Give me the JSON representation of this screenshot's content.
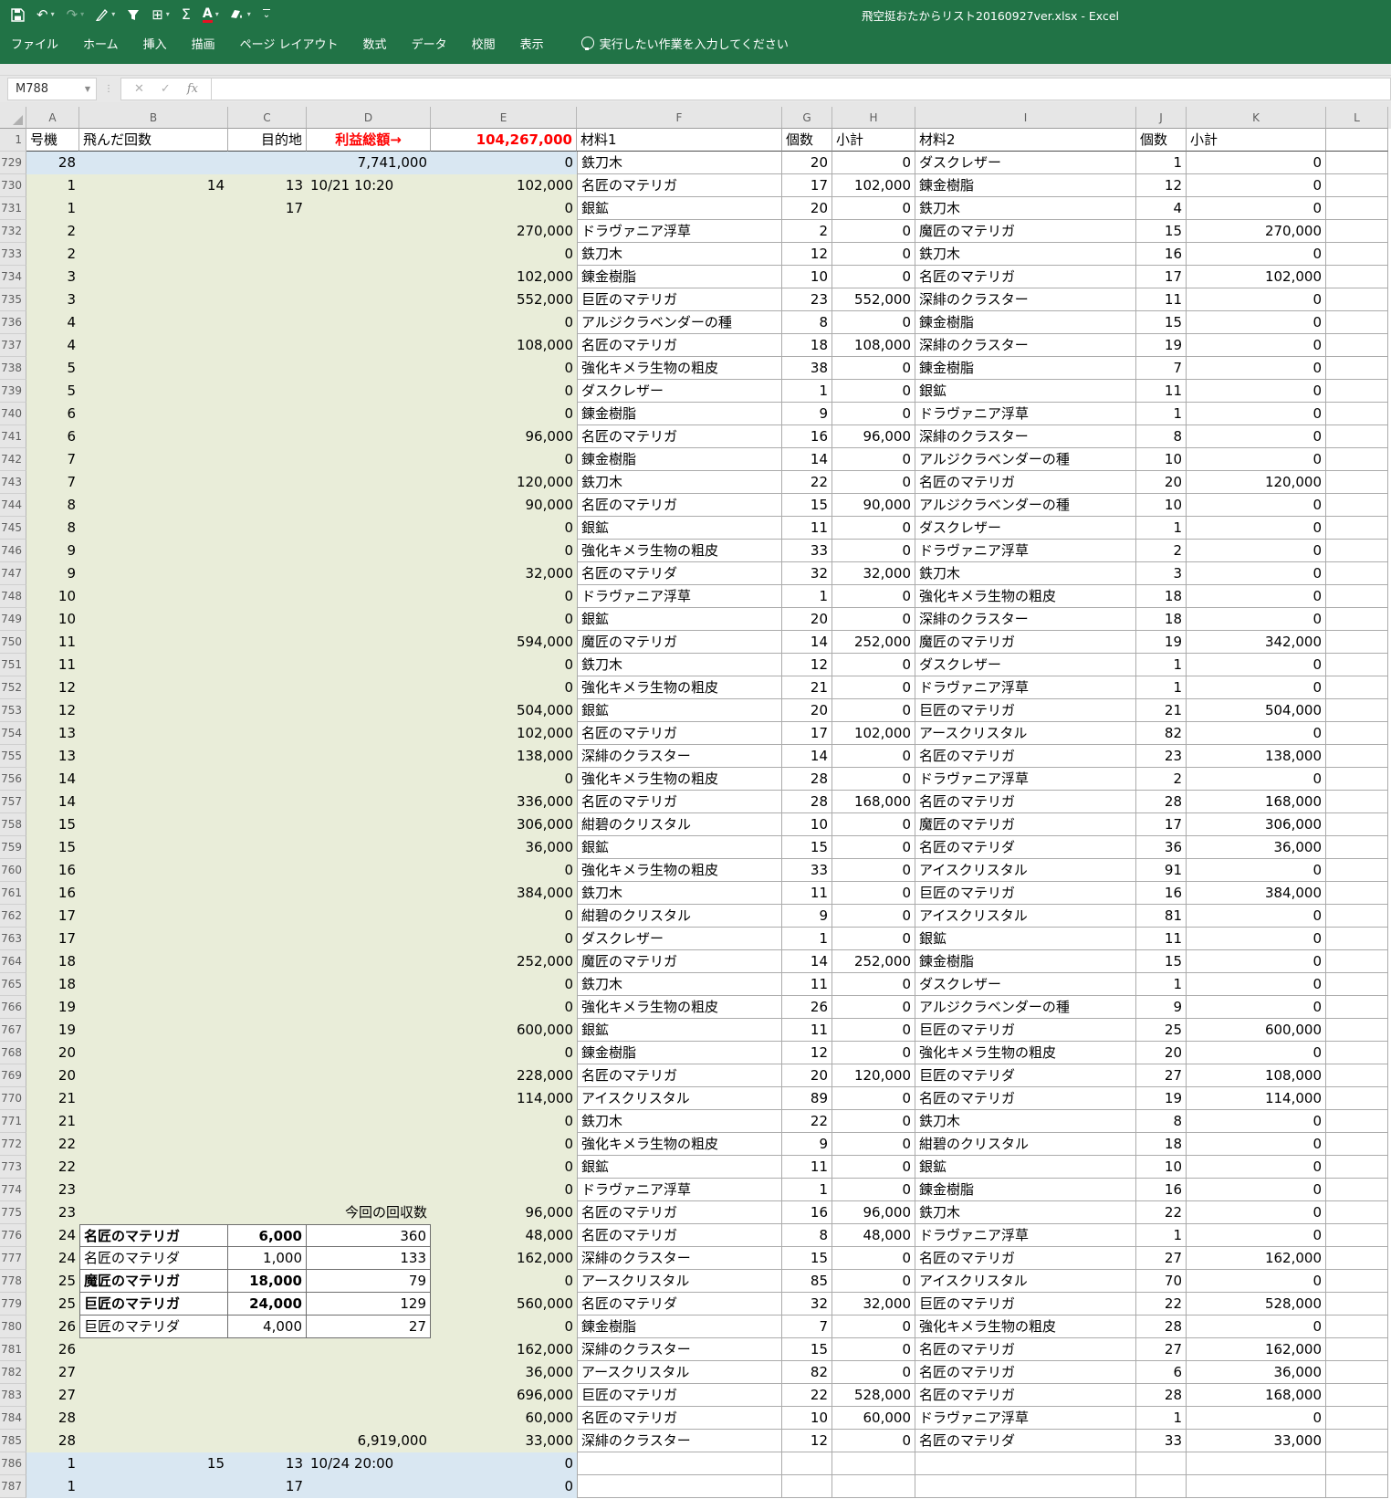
{
  "titlebar": {
    "title": "飛空挺おたからリスト20160927ver.xlsx  -  Excel"
  },
  "qat": {
    "icons": [
      "save-icon",
      "undo-icon",
      "redo-icon",
      "ink-pen-icon",
      "filter-icon",
      "borders-icon",
      "autosum-icon",
      "font-color-icon",
      "fill-color-icon",
      "customize-qat-icon"
    ],
    "undo_glyph": "↶",
    "redo_glyph": "↷",
    "borders_glyph": "⊞",
    "autosum_glyph": "Σ",
    "font_color_glyph": "A",
    "caret_glyph": "▾",
    "customize_glyph": "⌄"
  },
  "ribbon": {
    "tabs": [
      "ファイル",
      "ホーム",
      "挿入",
      "描画",
      "ページ レイアウト",
      "数式",
      "データ",
      "校閲",
      "表示"
    ],
    "tell_me": "実行したい作業を入力してください"
  },
  "formula_bar": {
    "name_box": "M788",
    "name_caret": "▼",
    "dots": "⋮",
    "cancel_glyph": "✕",
    "enter_glyph": "✓",
    "fx_glyph": "fx",
    "formula_value": ""
  },
  "grid": {
    "column_letters": [
      "A",
      "B",
      "C",
      "D",
      "E",
      "F",
      "G",
      "H",
      "I",
      "J",
      "K",
      "L"
    ],
    "header_row": {
      "n": "1",
      "cells": [
        "号機",
        "飛んだ回数",
        "目的地",
        "利益総額→",
        "104,267,000",
        "材料1",
        "個数",
        "小計",
        "材料2",
        "個数",
        "小計"
      ]
    },
    "colors": {
      "red_accent": "#ff0000",
      "blue_fill": "#d9e7f2",
      "green_fill": "#e9edd9",
      "chrome_green": "#217346"
    },
    "rows": [
      {
        "n": 729,
        "t": "blue",
        "c": [
          "28",
          "",
          "",
          "7,741,000",
          "0",
          "鉄刀木",
          "20",
          "0",
          "ダスクレザー",
          "1",
          "0"
        ]
      },
      {
        "n": 730,
        "t": "green",
        "c": [
          "1",
          "14",
          "13",
          "10/21 10:20",
          "102,000",
          "名匠のマテリガ",
          "17",
          "102,000",
          "錬金樹脂",
          "12",
          "0"
        ]
      },
      {
        "n": 731,
        "t": "green",
        "c": [
          "1",
          "",
          "17",
          "",
          "0",
          "銀鉱",
          "20",
          "0",
          "鉄刀木",
          "4",
          "0"
        ]
      },
      {
        "n": 732,
        "t": "green",
        "c": [
          "2",
          "",
          "",
          "",
          "270,000",
          "ドラヴァニア浮草",
          "2",
          "0",
          "魔匠のマテリガ",
          "15",
          "270,000"
        ]
      },
      {
        "n": 733,
        "t": "green",
        "c": [
          "2",
          "",
          "",
          "",
          "0",
          "鉄刀木",
          "12",
          "0",
          "鉄刀木",
          "16",
          "0"
        ]
      },
      {
        "n": 734,
        "t": "green",
        "c": [
          "3",
          "",
          "",
          "",
          "102,000",
          "錬金樹脂",
          "10",
          "0",
          "名匠のマテリガ",
          "17",
          "102,000"
        ]
      },
      {
        "n": 735,
        "t": "green",
        "c": [
          "3",
          "",
          "",
          "",
          "552,000",
          "巨匠のマテリガ",
          "23",
          "552,000",
          "深緋のクラスター",
          "11",
          "0"
        ]
      },
      {
        "n": 736,
        "t": "green",
        "c": [
          "4",
          "",
          "",
          "",
          "0",
          "アルジクラベンダーの種",
          "8",
          "0",
          "錬金樹脂",
          "15",
          "0"
        ]
      },
      {
        "n": 737,
        "t": "green",
        "c": [
          "4",
          "",
          "",
          "",
          "108,000",
          "名匠のマテリガ",
          "18",
          "108,000",
          "深緋のクラスター",
          "19",
          "0"
        ]
      },
      {
        "n": 738,
        "t": "green",
        "c": [
          "5",
          "",
          "",
          "",
          "0",
          "強化キメラ生物の粗皮",
          "38",
          "0",
          "錬金樹脂",
          "7",
          "0"
        ]
      },
      {
        "n": 739,
        "t": "green",
        "c": [
          "5",
          "",
          "",
          "",
          "0",
          "ダスクレザー",
          "1",
          "0",
          "銀鉱",
          "11",
          "0"
        ]
      },
      {
        "n": 740,
        "t": "green",
        "c": [
          "6",
          "",
          "",
          "",
          "0",
          "錬金樹脂",
          "9",
          "0",
          "ドラヴァニア浮草",
          "1",
          "0"
        ]
      },
      {
        "n": 741,
        "t": "green",
        "c": [
          "6",
          "",
          "",
          "",
          "96,000",
          "名匠のマテリガ",
          "16",
          "96,000",
          "深緋のクラスター",
          "8",
          "0"
        ]
      },
      {
        "n": 742,
        "t": "green",
        "c": [
          "7",
          "",
          "",
          "",
          "0",
          "錬金樹脂",
          "14",
          "0",
          "アルジクラベンダーの種",
          "10",
          "0"
        ]
      },
      {
        "n": 743,
        "t": "green",
        "c": [
          "7",
          "",
          "",
          "",
          "120,000",
          "鉄刀木",
          "22",
          "0",
          "名匠のマテリガ",
          "20",
          "120,000"
        ]
      },
      {
        "n": 744,
        "t": "green",
        "c": [
          "8",
          "",
          "",
          "",
          "90,000",
          "名匠のマテリガ",
          "15",
          "90,000",
          "アルジクラベンダーの種",
          "10",
          "0"
        ]
      },
      {
        "n": 745,
        "t": "green",
        "c": [
          "8",
          "",
          "",
          "",
          "0",
          "銀鉱",
          "11",
          "0",
          "ダスクレザー",
          "1",
          "0"
        ]
      },
      {
        "n": 746,
        "t": "green",
        "c": [
          "9",
          "",
          "",
          "",
          "0",
          "強化キメラ生物の粗皮",
          "33",
          "0",
          "ドラヴァニア浮草",
          "2",
          "0"
        ]
      },
      {
        "n": 747,
        "t": "green",
        "c": [
          "9",
          "",
          "",
          "",
          "32,000",
          "名匠のマテリダ",
          "32",
          "32,000",
          "鉄刀木",
          "3",
          "0"
        ]
      },
      {
        "n": 748,
        "t": "green",
        "c": [
          "10",
          "",
          "",
          "",
          "0",
          "ドラヴァニア浮草",
          "1",
          "0",
          "強化キメラ生物の粗皮",
          "18",
          "0"
        ]
      },
      {
        "n": 749,
        "t": "green",
        "c": [
          "10",
          "",
          "",
          "",
          "0",
          "銀鉱",
          "20",
          "0",
          "深緋のクラスター",
          "18",
          "0"
        ]
      },
      {
        "n": 750,
        "t": "green",
        "c": [
          "11",
          "",
          "",
          "",
          "594,000",
          "魔匠のマテリガ",
          "14",
          "252,000",
          "魔匠のマテリガ",
          "19",
          "342,000"
        ]
      },
      {
        "n": 751,
        "t": "green",
        "c": [
          "11",
          "",
          "",
          "",
          "0",
          "鉄刀木",
          "12",
          "0",
          "ダスクレザー",
          "1",
          "0"
        ]
      },
      {
        "n": 752,
        "t": "green",
        "c": [
          "12",
          "",
          "",
          "",
          "0",
          "強化キメラ生物の粗皮",
          "21",
          "0",
          "ドラヴァニア浮草",
          "1",
          "0"
        ]
      },
      {
        "n": 753,
        "t": "green",
        "c": [
          "12",
          "",
          "",
          "",
          "504,000",
          "銀鉱",
          "20",
          "0",
          "巨匠のマテリガ",
          "21",
          "504,000"
        ]
      },
      {
        "n": 754,
        "t": "green",
        "c": [
          "13",
          "",
          "",
          "",
          "102,000",
          "名匠のマテリガ",
          "17",
          "102,000",
          "アースクリスタル",
          "82",
          "0"
        ]
      },
      {
        "n": 755,
        "t": "green",
        "c": [
          "13",
          "",
          "",
          "",
          "138,000",
          "深緋のクラスター",
          "14",
          "0",
          "名匠のマテリガ",
          "23",
          "138,000"
        ]
      },
      {
        "n": 756,
        "t": "green",
        "c": [
          "14",
          "",
          "",
          "",
          "0",
          "強化キメラ生物の粗皮",
          "28",
          "0",
          "ドラヴァニア浮草",
          "2",
          "0"
        ]
      },
      {
        "n": 757,
        "t": "green",
        "c": [
          "14",
          "",
          "",
          "",
          "336,000",
          "名匠のマテリガ",
          "28",
          "168,000",
          "名匠のマテリガ",
          "28",
          "168,000"
        ]
      },
      {
        "n": 758,
        "t": "green",
        "c": [
          "15",
          "",
          "",
          "",
          "306,000",
          "紺碧のクリスタル",
          "10",
          "0",
          "魔匠のマテリガ",
          "17",
          "306,000"
        ]
      },
      {
        "n": 759,
        "t": "green",
        "c": [
          "15",
          "",
          "",
          "",
          "36,000",
          "銀鉱",
          "15",
          "0",
          "名匠のマテリダ",
          "36",
          "36,000"
        ]
      },
      {
        "n": 760,
        "t": "green",
        "c": [
          "16",
          "",
          "",
          "",
          "0",
          "強化キメラ生物の粗皮",
          "33",
          "0",
          "アイスクリスタル",
          "91",
          "0"
        ]
      },
      {
        "n": 761,
        "t": "green",
        "c": [
          "16",
          "",
          "",
          "",
          "384,000",
          "鉄刀木",
          "11",
          "0",
          "巨匠のマテリガ",
          "16",
          "384,000"
        ]
      },
      {
        "n": 762,
        "t": "green",
        "c": [
          "17",
          "",
          "",
          "",
          "0",
          "紺碧のクリスタル",
          "9",
          "0",
          "アイスクリスタル",
          "81",
          "0"
        ]
      },
      {
        "n": 763,
        "t": "green",
        "c": [
          "17",
          "",
          "",
          "",
          "0",
          "ダスクレザー",
          "1",
          "0",
          "銀鉱",
          "11",
          "0"
        ]
      },
      {
        "n": 764,
        "t": "green",
        "c": [
          "18",
          "",
          "",
          "",
          "252,000",
          "魔匠のマテリガ",
          "14",
          "252,000",
          "錬金樹脂",
          "15",
          "0"
        ]
      },
      {
        "n": 765,
        "t": "green",
        "c": [
          "18",
          "",
          "",
          "",
          "0",
          "鉄刀木",
          "11",
          "0",
          "ダスクレザー",
          "1",
          "0"
        ]
      },
      {
        "n": 766,
        "t": "green",
        "c": [
          "19",
          "",
          "",
          "",
          "0",
          "強化キメラ生物の粗皮",
          "26",
          "0",
          "アルジクラベンダーの種",
          "9",
          "0"
        ]
      },
      {
        "n": 767,
        "t": "green",
        "c": [
          "19",
          "",
          "",
          "",
          "600,000",
          "銀鉱",
          "11",
          "0",
          "巨匠のマテリガ",
          "25",
          "600,000"
        ]
      },
      {
        "n": 768,
        "t": "green",
        "c": [
          "20",
          "",
          "",
          "",
          "0",
          "錬金樹脂",
          "12",
          "0",
          "強化キメラ生物の粗皮",
          "20",
          "0"
        ]
      },
      {
        "n": 769,
        "t": "green",
        "c": [
          "20",
          "",
          "",
          "",
          "228,000",
          "名匠のマテリガ",
          "20",
          "120,000",
          "巨匠のマテリダ",
          "27",
          "108,000"
        ]
      },
      {
        "n": 770,
        "t": "green",
        "c": [
          "21",
          "",
          "",
          "",
          "114,000",
          "アイスクリスタル",
          "89",
          "0",
          "名匠のマテリガ",
          "19",
          "114,000"
        ]
      },
      {
        "n": 771,
        "t": "green",
        "c": [
          "21",
          "",
          "",
          "",
          "0",
          "鉄刀木",
          "22",
          "0",
          "鉄刀木",
          "8",
          "0"
        ]
      },
      {
        "n": 772,
        "t": "green",
        "c": [
          "22",
          "",
          "",
          "",
          "0",
          "強化キメラ生物の粗皮",
          "9",
          "0",
          "紺碧のクリスタル",
          "18",
          "0"
        ]
      },
      {
        "n": 773,
        "t": "green",
        "c": [
          "22",
          "",
          "",
          "",
          "0",
          "銀鉱",
          "11",
          "0",
          "銀鉱",
          "10",
          "0"
        ]
      },
      {
        "n": 774,
        "t": "green",
        "c": [
          "23",
          "",
          "",
          "",
          "0",
          "ドラヴァニア浮草",
          "1",
          "0",
          "錬金樹脂",
          "16",
          "0"
        ]
      },
      {
        "n": 775,
        "t": "green",
        "c": [
          "23",
          "",
          "",
          "今回の回収数",
          "96,000",
          "名匠のマテリガ",
          "16",
          "96,000",
          "鉄刀木",
          "22",
          "0"
        ]
      },
      {
        "n": 776,
        "t": "green",
        "c": [
          "24",
          "名匠のマテリガ",
          "6,000",
          "360",
          "48,000",
          "名匠のマテリガ",
          "8",
          "48,000",
          "ドラヴァニア浮草",
          "1",
          "0"
        ],
        "box": [
          1,
          2,
          3
        ],
        "box_top": true,
        "bold": [
          1,
          2
        ]
      },
      {
        "n": 777,
        "t": "green",
        "c": [
          "24",
          "名匠のマテリダ",
          "1,000",
          "133",
          "162,000",
          "深緋のクラスター",
          "15",
          "0",
          "名匠のマテリガ",
          "27",
          "162,000"
        ],
        "box": [
          1,
          2,
          3
        ]
      },
      {
        "n": 778,
        "t": "green",
        "c": [
          "25",
          "魔匠のマテリガ",
          "18,000",
          "79",
          "0",
          "アースクリスタル",
          "85",
          "0",
          "アイスクリスタル",
          "70",
          "0"
        ],
        "box": [
          1,
          2,
          3
        ],
        "bold": [
          1,
          2
        ]
      },
      {
        "n": 779,
        "t": "green",
        "c": [
          "25",
          "巨匠のマテリガ",
          "24,000",
          "129",
          "560,000",
          "名匠のマテリダ",
          "32",
          "32,000",
          "巨匠のマテリガ",
          "22",
          "528,000"
        ],
        "box": [
          1,
          2,
          3
        ],
        "bold": [
          1,
          2
        ]
      },
      {
        "n": 780,
        "t": "green",
        "c": [
          "26",
          "巨匠のマテリダ",
          "4,000",
          "27",
          "0",
          "錬金樹脂",
          "7",
          "0",
          "強化キメラ生物の粗皮",
          "28",
          "0"
        ],
        "box": [
          1,
          2,
          3
        ]
      },
      {
        "n": 781,
        "t": "green",
        "c": [
          "26",
          "",
          "",
          "",
          "162,000",
          "深緋のクラスター",
          "15",
          "0",
          "名匠のマテリガ",
          "27",
          "162,000"
        ]
      },
      {
        "n": 782,
        "t": "green",
        "c": [
          "27",
          "",
          "",
          "",
          "36,000",
          "アースクリスタル",
          "82",
          "0",
          "名匠のマテリガ",
          "6",
          "36,000"
        ]
      },
      {
        "n": 783,
        "t": "green",
        "c": [
          "27",
          "",
          "",
          "",
          "696,000",
          "巨匠のマテリガ",
          "22",
          "528,000",
          "名匠のマテリガ",
          "28",
          "168,000"
        ]
      },
      {
        "n": 784,
        "t": "green",
        "c": [
          "28",
          "",
          "",
          "",
          "60,000",
          "名匠のマテリガ",
          "10",
          "60,000",
          "ドラヴァニア浮草",
          "1",
          "0"
        ]
      },
      {
        "n": 785,
        "t": "green",
        "c": [
          "28",
          "",
          "",
          "6,919,000",
          "33,000",
          "深緋のクラスター",
          "12",
          "0",
          "名匠のマテリダ",
          "33",
          "33,000"
        ]
      },
      {
        "n": 786,
        "t": "blue",
        "c": [
          "1",
          "15",
          "13",
          "10/24 20:00",
          "0",
          "",
          "",
          "",
          "",
          "",
          ""
        ]
      },
      {
        "n": 787,
        "t": "blue",
        "c": [
          "1",
          "",
          "17",
          "",
          "0",
          "",
          "",
          "",
          "",
          "",
          ""
        ]
      }
    ]
  }
}
